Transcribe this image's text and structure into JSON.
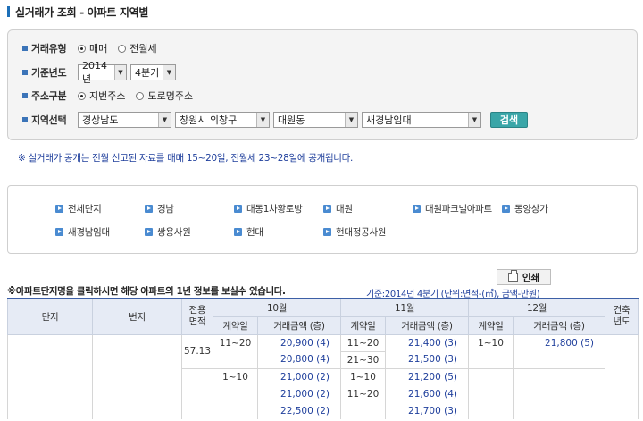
{
  "page_title": "실거래가 조회 - 아파트 지역별",
  "filters": {
    "deal_type": {
      "label": "거래유형",
      "options": [
        {
          "label": "매매",
          "selected": true
        },
        {
          "label": "전월세",
          "selected": false
        }
      ]
    },
    "base_year": {
      "label": "기준년도",
      "year": "2014년",
      "quarter": "4분기"
    },
    "address_type": {
      "label": "주소구분",
      "options": [
        {
          "label": "지번주소",
          "selected": true
        },
        {
          "label": "도로명주소",
          "selected": false
        }
      ]
    },
    "region": {
      "label": "지역선택",
      "province": "경상남도",
      "city": "창원시 의창구",
      "dong": "대원동",
      "apartment": "새경남임대",
      "search_label": "검색"
    }
  },
  "notice": "※ 실거래가 공개는 전월 신고된 자료를 매매 15~20일, 전월세 23~28일에 공개됩니다.",
  "apartments": [
    "전체단지",
    "경남",
    "대동1차황토방",
    "대원",
    "대원파크빌아파트",
    "동양상가",
    "새경남임대",
    "쌍용사원",
    "현대",
    "현대정공사원"
  ],
  "print_label": "인쇄",
  "hint": "※아파트단지명을 클릭하시면 해당 아파트의 1년 정보를 보실수 있습니다.",
  "basis": "기준:2014년 4분기   (단위:면적-(㎡), 금액-만원)",
  "table": {
    "headers": {
      "complex": "단지",
      "lot": "번지",
      "area": "전용\n면적",
      "months": [
        "10월",
        "11월",
        "12월"
      ],
      "contract_day": "계약일",
      "amount": "거래금액 (층)",
      "built_year": "건축\n년도"
    },
    "rows": [
      {
        "area": "57.13",
        "m10d": "11~20",
        "m10a": "20,900 (4)",
        "m11d": "11~20",
        "m11a": "21,400 (3)",
        "m12d": "1~10",
        "m12a": "21,800 (5)"
      },
      {
        "area": "",
        "m10d": "",
        "m10a": "20,800 (4)",
        "m11d": "21~30",
        "m11a": "21,500 (3)",
        "m12d": "",
        "m12a": ""
      },
      {
        "area": "",
        "m10d": "1~10",
        "m10a": "21,000 (2)",
        "m11d": "1~10",
        "m11a": "21,200 (5)",
        "m12d": "",
        "m12a": ""
      },
      {
        "area": "",
        "m10d": "",
        "m10a": "21,000 (2)",
        "m11d": "11~20",
        "m11a": "21,600 (4)",
        "m12d": "",
        "m12a": ""
      },
      {
        "area": "",
        "m10d": "",
        "m10a": "22,500 (2)",
        "m11d": "",
        "m11a": "21,700 (3)",
        "m12d": "",
        "m12a": ""
      }
    ]
  },
  "colors": {
    "accent": "#1d6fb8",
    "search_button": "#3aa6a8",
    "link_text": "#1f3f9c",
    "header_bg": "#e6ebf5"
  }
}
